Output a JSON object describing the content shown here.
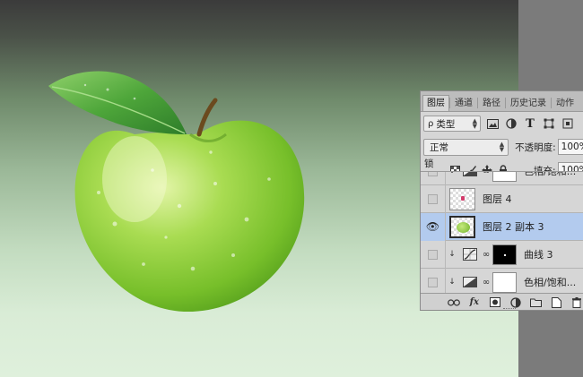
{
  "panel": {
    "tabs": [
      {
        "label": "图层",
        "active": true
      },
      {
        "label": "通道",
        "active": false
      },
      {
        "label": "路径",
        "active": false
      },
      {
        "label": "历史记录",
        "active": false
      },
      {
        "label": "动作",
        "active": false
      }
    ],
    "filter": {
      "kind_label": "类型",
      "search_icon": "ρ"
    },
    "filter_icons": [
      "image-filter-icon",
      "adjustment-filter-icon",
      "type-filter-icon",
      "shape-filter-icon",
      "smart-object-filter-icon"
    ],
    "blend_mode": "正常",
    "opacity_label": "不透明度:",
    "opacity_value": "100%",
    "lock_label": "锁定:",
    "lock_icons": [
      "lock-transparent-icon",
      "lock-image-icon",
      "lock-position-icon",
      "lock-all-icon"
    ],
    "fill_label": "填充:",
    "fill_value": "100%",
    "glyphs": {
      "type": "T",
      "fx": "fx",
      "eye": "👁",
      "clip": "↓",
      "chain": "∞"
    },
    "layers": [
      {
        "name": "色相/饱和...",
        "visible": false,
        "clipped": true,
        "kind": "hue-saturation",
        "mask": "white"
      },
      {
        "name": "图层 4",
        "visible": false,
        "clipped": false,
        "kind": "pixel"
      },
      {
        "name": "图层 2 副本 3",
        "visible": true,
        "selected": true,
        "clipped": false,
        "kind": "pixel-apple"
      },
      {
        "name": "曲线 3",
        "visible": false,
        "clipped": true,
        "kind": "curves",
        "mask": "black"
      },
      {
        "name": "色相/饱和...",
        "visible": false,
        "clipped": true,
        "kind": "hue-saturation",
        "mask": "white"
      }
    ],
    "bottom_icons": [
      "link-layers-icon",
      "fx-icon",
      "add-mask-icon",
      "adjustment-layer-icon",
      "new-group-icon",
      "new-layer-icon",
      "delete-layer-icon"
    ]
  },
  "colors": {
    "selected_row": "#b3cbee",
    "panel_bg": "#d6d6d6",
    "apple": "#8fcf3a",
    "leaf": "#4ea63a"
  }
}
